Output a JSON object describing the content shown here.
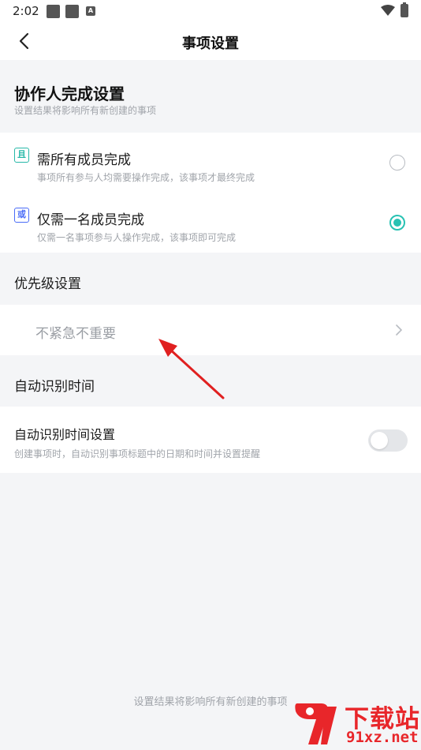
{
  "status_bar": {
    "time": "2:02",
    "mini_badge": "A"
  },
  "header": {
    "title": "事项设置"
  },
  "collab": {
    "title": "协作人完成设置",
    "subtitle": "设置结果将影响所有新创建的事项",
    "options": [
      {
        "badge": "且",
        "title": "需所有成员完成",
        "desc": "事项所有参与人均需要操作完成，该事项才最终完成",
        "selected": false
      },
      {
        "badge": "或",
        "title": "仅需一名成员完成",
        "desc": "仅需一名事项参与人操作完成，该事项即可完成",
        "selected": true
      }
    ]
  },
  "priority": {
    "title": "优先级设置",
    "value": "不紧急不重要"
  },
  "auto_time": {
    "section_title": "自动识别时间",
    "item_title": "自动识别时间设置",
    "item_desc": "创建事项时，自动识别事项标题中的日期和时间并设置提醒",
    "enabled": false
  },
  "footer_note": "设置结果将影响所有新创建的事项",
  "watermark": {
    "name": "下载站",
    "domain": "91xz.net"
  },
  "colors": {
    "accent": "#27c2b3",
    "badge_or": "#4a6cf7",
    "annotation_arrow": "#e02020",
    "watermark": "#e8262a"
  }
}
